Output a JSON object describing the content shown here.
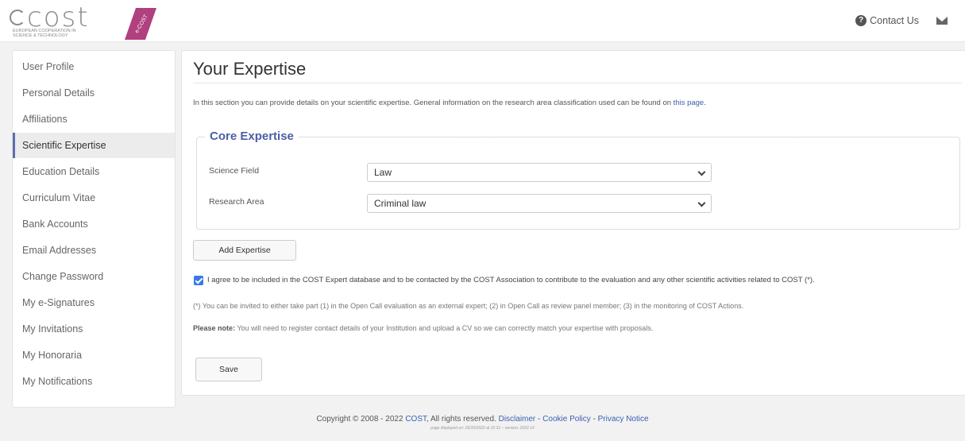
{
  "header": {
    "logo_word": "cost",
    "logo_tagline": "European Cooperation in Science & Technology",
    "badge": "e-COST",
    "contact_label": "Contact Us"
  },
  "sidebar": {
    "items": [
      {
        "label": "User Profile"
      },
      {
        "label": "Personal Details"
      },
      {
        "label": "Affiliations"
      },
      {
        "label": "Scientific Expertise"
      },
      {
        "label": "Education Details"
      },
      {
        "label": "Curriculum Vitae"
      },
      {
        "label": "Bank Accounts"
      },
      {
        "label": "Email Addresses"
      },
      {
        "label": "Change Password"
      },
      {
        "label": "My e-Signatures"
      },
      {
        "label": "My Invitations"
      },
      {
        "label": "My Honoraria"
      },
      {
        "label": "My Notifications"
      }
    ],
    "active_index": 3
  },
  "main": {
    "title": "Your Expertise",
    "intro_text": "In this section you can provide details on your scientific expertise. General information on the research area classification used can be found on",
    "intro_link": "this page",
    "intro_end": ".",
    "core": {
      "legend": "Core Expertise",
      "science_field_label": "Science Field",
      "science_field_value": "Law",
      "research_area_label": "Research Area",
      "research_area_value": "Criminal law"
    },
    "add_button": "Add Expertise",
    "agree_checked": true,
    "agree_text": "I agree to be included in the COST Expert database and to be contacted by the COST Association to contribute to the evaluation and any other scientific activities related to COST (*).",
    "footnote": "(*) You can be invited to either take part (1) in the Open Call evaluation as an external expert; (2) in Open Call as review panel member; (3) in the monitoring of COST Actions.",
    "please_note_label": "Please note:",
    "please_note_text": "You will need to register contact details of your Institution and upload a CV so we can correctly match your expertise with proposals.",
    "save_button": "Save"
  },
  "footer": {
    "copyright": "Copyright © 2008 - 2022",
    "cost_link": "COST",
    "rights": ", All rights reserved.",
    "disclaimer": "Disclaimer",
    "cookie": "Cookie Policy",
    "privacy": "Privacy Notice",
    "sep": " - ",
    "page_info": "page displayed on: 26/10/2022 at 10:31 – version: 2022.14"
  },
  "colors": {
    "accent": "#4b5fa3",
    "link": "#3a5fb0",
    "checkbox": "#3b78e7"
  }
}
